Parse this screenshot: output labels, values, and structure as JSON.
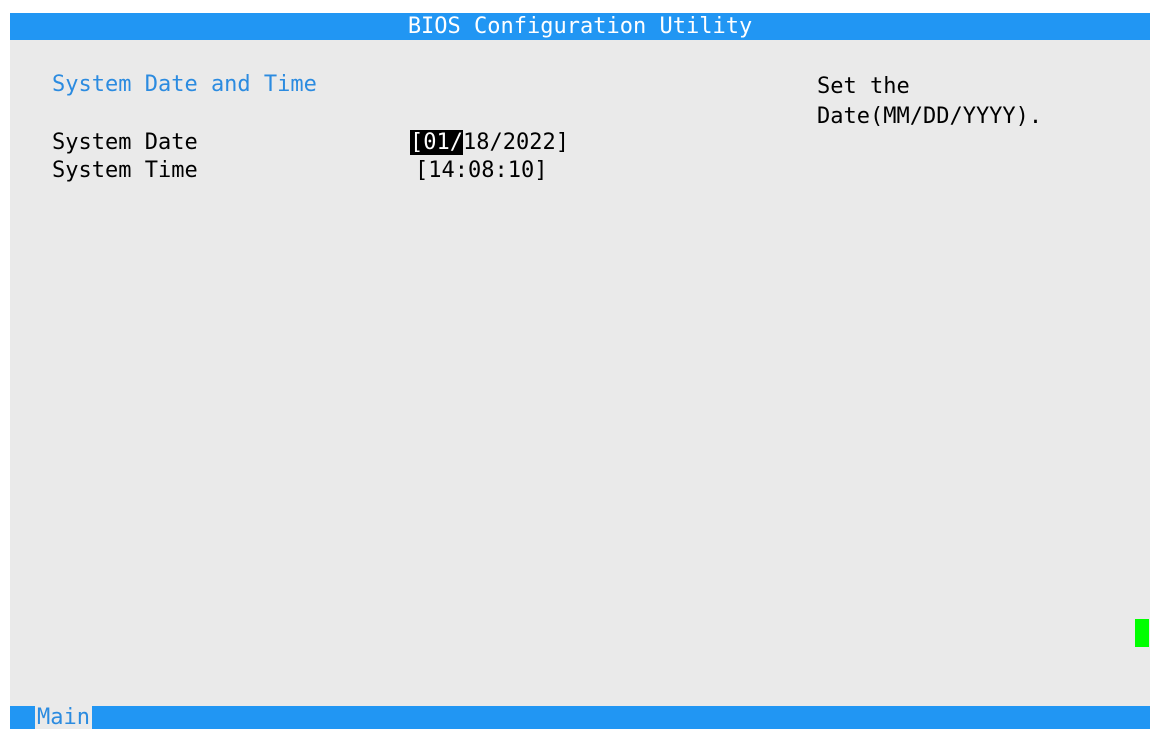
{
  "window": {
    "title": "BIOS Configuration Utility"
  },
  "page": {
    "section_title": "System Date and Time",
    "help_text_line1": "Set the",
    "help_text_line2": "Date(MM/DD/YYYY)."
  },
  "settings": {
    "system_date": {
      "label": "System Date",
      "value_selected": "[01/",
      "value_rest": "18/2022]"
    },
    "system_time": {
      "label": "System Time",
      "value": "[14:08:10]"
    }
  },
  "bottom_tabs": [
    {
      "label": "Main"
    }
  ],
  "colors": {
    "title_bar": "#2196f3",
    "background": "#eaeaea",
    "section_title": "#2b8be0",
    "cursor": "#00ff00",
    "selection_bg": "#000000",
    "selection_fg": "#ffffff"
  }
}
